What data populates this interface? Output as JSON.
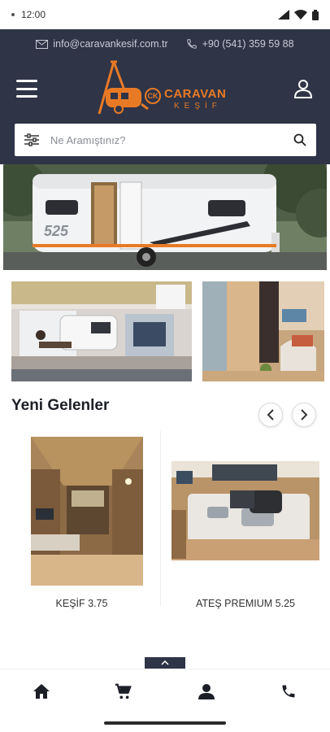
{
  "status_bar": {
    "time": "12:00"
  },
  "contact": {
    "email": "info@caravankesif.com.tr",
    "phone": "+90 (541) 359 59 88"
  },
  "logo": {
    "brand": "CARAVAN",
    "sub": "KEŞİF",
    "mark": "CK"
  },
  "search": {
    "placeholder": "Ne Aramıştınız?"
  },
  "hero": {
    "model_badge": "525"
  },
  "section": {
    "title": "Yeni Gelenler"
  },
  "products": [
    {
      "name": "KEŞİF 3.75"
    },
    {
      "name": "ATEŞ PREMIUM 5.25"
    }
  ],
  "colors": {
    "header_bg": "#2f3447",
    "accent": "#e87a25",
    "text": "#1d1f27"
  },
  "bottom_nav": {
    "icons": [
      "home-icon",
      "cart-icon",
      "user-icon",
      "phone-icon"
    ]
  }
}
